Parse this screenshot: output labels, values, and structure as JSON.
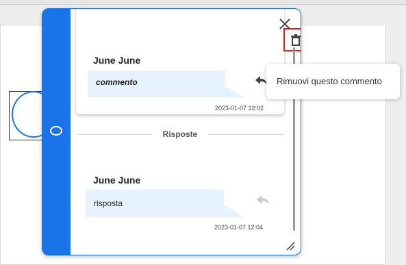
{
  "comment_panel": {
    "comment": {
      "author": "June June",
      "text": "commento",
      "timestamp": "2023-01-07 12:02"
    },
    "replies_label": "Risposte",
    "reply": {
      "author": "June June",
      "text": "risposta",
      "timestamp": "2023-01-07 12:04"
    }
  },
  "tooltip": {
    "text": "Rimuovi questo commento"
  },
  "icons": {
    "close": "close-icon",
    "delete": "trash-icon",
    "reply": "reply-icon",
    "resize": "resize-grip-icon",
    "marker": "ellipse-marker-icon"
  },
  "colors": {
    "accent": "#1a73e8",
    "bubble": "#e6f2fd",
    "highlight": "#e01b1b"
  }
}
